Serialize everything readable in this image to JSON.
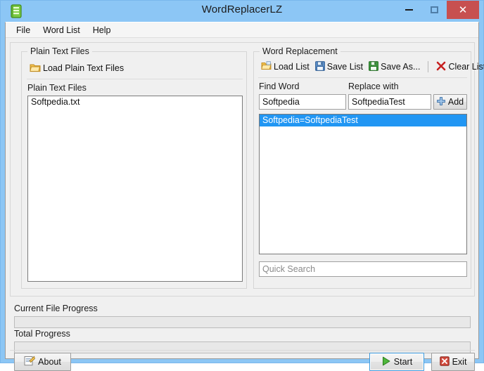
{
  "window": {
    "title": "WordReplacerLZ",
    "icon": "app-green-book-icon",
    "controls": {
      "minimize": "minimize-icon",
      "maximize": "maximize-icon",
      "close": "close-icon"
    },
    "frame_color": "#8cc6f5",
    "close_button_color": "#c75050"
  },
  "menubar": {
    "items": [
      {
        "label": "File",
        "name": "menu-file"
      },
      {
        "label": "Word List",
        "name": "menu-word-list"
      },
      {
        "label": "Help",
        "name": "menu-help"
      }
    ]
  },
  "left_panel": {
    "group_title": "Plain Text Files",
    "load_button": {
      "label": "Load Plain Text Files",
      "icon": "open-folder-icon"
    },
    "list_label": "Plain Text Files",
    "files": [
      "Softpedia.txt"
    ]
  },
  "right_panel": {
    "group_title": "Word Replacement",
    "toolbar": [
      {
        "label": "Load List",
        "icon": "open-folder-icon",
        "name": "load-list-button"
      },
      {
        "label": "Save List",
        "icon": "floppy-blue-icon",
        "name": "save-list-button"
      },
      {
        "label": "Save As...",
        "icon": "floppy-green-icon",
        "name": "save-as-button"
      },
      {
        "label": "Clear List",
        "icon": "red-x-icon",
        "name": "clear-list-button"
      }
    ],
    "find_label": "Find Word",
    "find_value": "Softpedia",
    "replace_label": "Replace with",
    "replace_value": "SoftpediaTest",
    "add_button": {
      "label": "Add",
      "icon": "blue-plus-icon"
    },
    "word_list": [
      {
        "text": "Softpedia=SoftpediaTest",
        "selected": true
      }
    ],
    "selection_color": "#2196f3",
    "quick_search_placeholder": "Quick Search",
    "quick_search_value": ""
  },
  "progress": {
    "current_file_label": "Current File Progress",
    "current_file_value": 0,
    "total_label": "Total Progress",
    "total_value": 0
  },
  "footer": {
    "about_button": {
      "label": "About",
      "icon": "about-note-icon"
    },
    "start_button": {
      "label": "Start",
      "icon": "green-play-icon"
    },
    "exit_button": {
      "label": "Exit",
      "icon": "red-x-box-icon"
    }
  }
}
